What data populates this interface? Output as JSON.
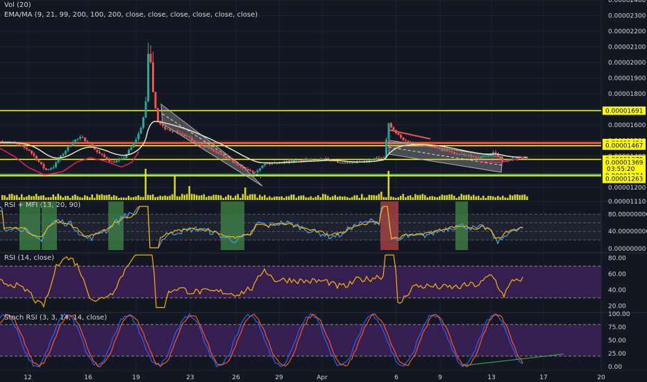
{
  "indicators": {
    "vol": "Vol (20)",
    "ema": "EMA/MA (9, 21, 99, 200, 100, 200, close, close, close, close, close, close)",
    "rsimfi": "RSI + MFI (13, 20, 90)",
    "rsi": "RSI (14, close)",
    "stoch": "Stoch RSI (3, 3, 14, 14, close)"
  },
  "colors": {
    "background": "#131722",
    "grid": "#1e2230",
    "bull": "#26a69a",
    "bear": "#ef5350",
    "yellow": "#ffff00",
    "orange": "#ff5722",
    "green": "#4caf50",
    "purple": "#3a1f55",
    "ema_white": "#e8e4c9",
    "ema_pink": "#e91e63",
    "rsi_blue": "#42a5f5",
    "rsi_orange": "#ffb300",
    "stoch_k": "#2962ff",
    "stoch_d": "#ff5722",
    "channel": "#b0b0b0"
  },
  "chart_data": [
    {
      "type": "candlestick",
      "name": "price",
      "y_ticks": [
        "0.00002400",
        "0.00002300",
        "0.00002200",
        "0.00002100",
        "0.00002000",
        "0.00001900",
        "0.00001800",
        "0.00001700",
        "0.00001600",
        "0.00001500",
        "0.00001400",
        "0.00001300",
        "0.00001200",
        "0.00001110"
      ],
      "ylim": [
        1.11e-05,
        2.4e-05
      ],
      "price_labels": [
        {
          "value": 1.691e-05,
          "text": "0.00001691",
          "color": "#ffff00"
        },
        {
          "value": 1.484e-05,
          "text": "0.00001484",
          "color": "#ffff00"
        },
        {
          "value": 1.467e-05,
          "text": "0.00001467",
          "color": "#ffff00"
        },
        {
          "value": 1.379e-05,
          "text": "0.00001379",
          "color": "#ffff00"
        },
        {
          "value": 1.369e-05,
          "text": "0.00001369",
          "color": "#ffff00"
        },
        {
          "value": 1.274e-05,
          "text": "0.00001274",
          "color": "#ffff00"
        },
        {
          "value": 1.263e-05,
          "text": "0.00001263",
          "color": "#ffff00"
        }
      ],
      "countdown": "03:55:20",
      "levels": [
        {
          "value": 1.691e-05,
          "color": "#ffff00"
        },
        {
          "value": 1.484e-05,
          "color": "#ff5722"
        },
        {
          "value": 1.467e-05,
          "color": "#ffff00"
        },
        {
          "value": 1.379e-05,
          "color": "#ffff00"
        },
        {
          "value": 1.28e-05,
          "color": "#4caf50"
        },
        {
          "value": 1.274e-05,
          "color": "#ffff00"
        }
      ]
    },
    {
      "type": "line",
      "name": "rsi_mfi",
      "y_ticks": [
        "80.00000000",
        "40.00000000",
        "0.00000000"
      ],
      "ylim": [
        0,
        100
      ]
    },
    {
      "type": "line",
      "name": "rsi",
      "y_ticks": [
        "80.00",
        "60.00",
        "40.00",
        "20.00"
      ],
      "ylim": [
        15,
        85
      ]
    },
    {
      "type": "line",
      "name": "stoch_rsi",
      "y_ticks": [
        "100.00",
        "75.00",
        "50.00",
        "25.00",
        "0.00"
      ],
      "ylim": [
        0,
        100
      ]
    }
  ],
  "x_axis": [
    "12",
    "16",
    "19",
    "23",
    "26",
    "29",
    "Apr",
    "6",
    "9",
    "13",
    "17",
    "20"
  ]
}
